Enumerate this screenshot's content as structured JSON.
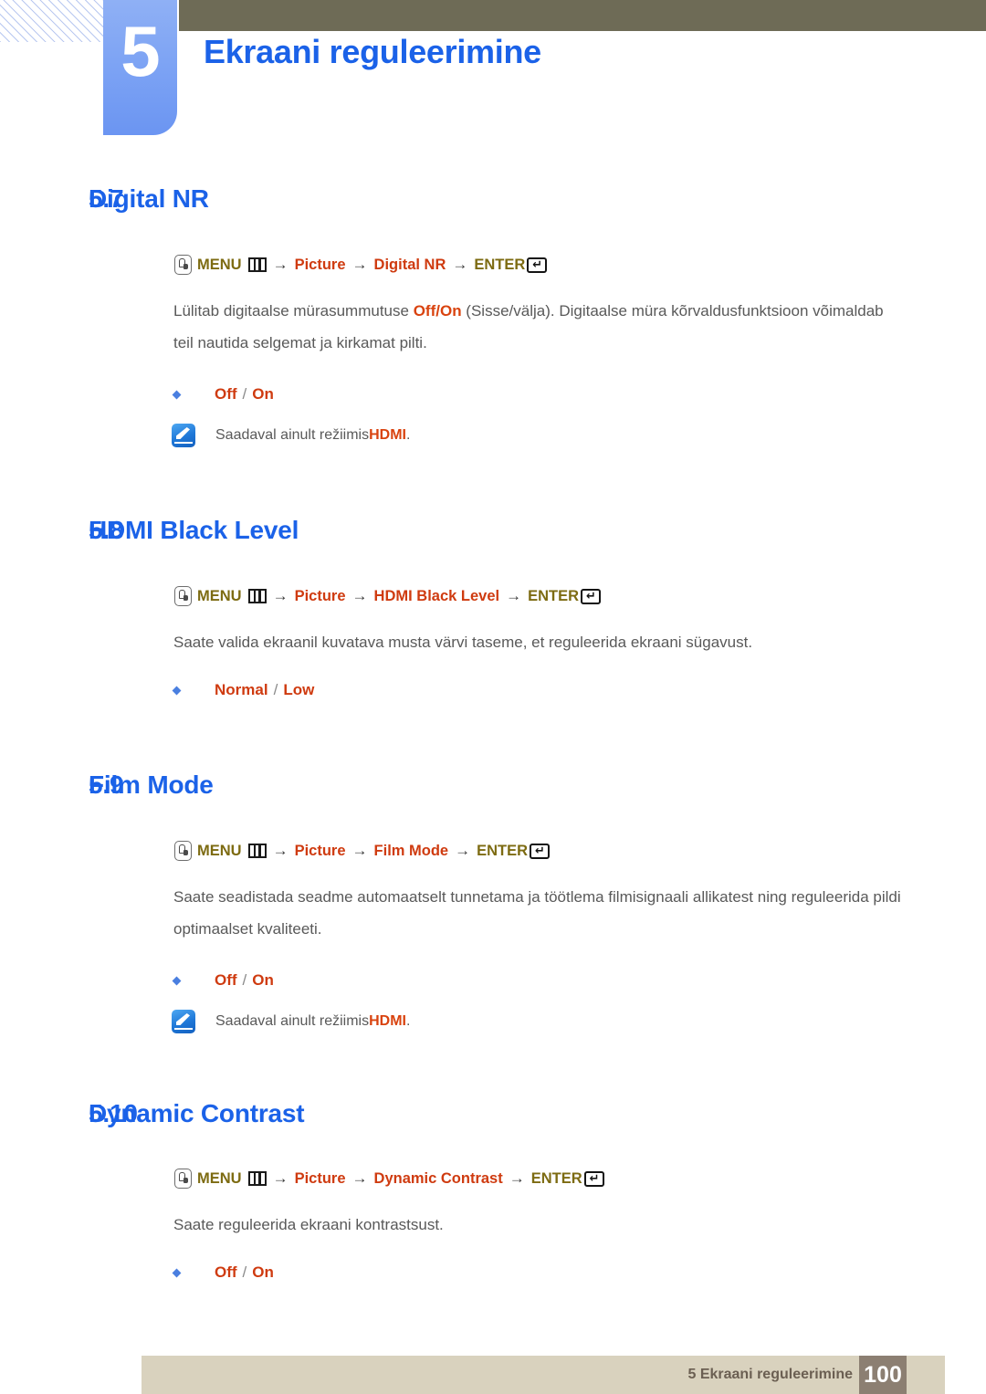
{
  "header": {
    "chapter_number": "5",
    "chapter_title": "Ekraani reguleerimine"
  },
  "sections": [
    {
      "number": "5.7",
      "title": "Digital NR",
      "menu_path": {
        "menu_label": "MENU",
        "arrow": "→",
        "steps": [
          "Picture",
          "Digital NR"
        ],
        "enter_label": "ENTER"
      },
      "body_prefix": "Lülitab digitaalse mürasummutuse ",
      "body_hl1": "Off",
      "body_mid": "/",
      "body_hl2": "On",
      "body_suffix": " (Sisse/välja). Digitaalse müra kõrvaldusfunktsioon võimaldab teil nautida selgemat ja kirkamat pilti.",
      "options": [
        "Off",
        "On"
      ],
      "option_separator": "/",
      "note_prefix": "Saadaval ainult režiimis ",
      "note_hl": "HDMI",
      "note_suffix": "."
    },
    {
      "number": "5.8",
      "title": "HDMI Black Level",
      "menu_path": {
        "menu_label": "MENU",
        "arrow": "→",
        "steps": [
          "Picture",
          "HDMI Black Level"
        ],
        "enter_label": "ENTER"
      },
      "body": "Saate valida ekraanil kuvatava musta värvi taseme, et reguleerida ekraani sügavust.",
      "options": [
        "Normal",
        "Low"
      ],
      "option_separator": "/"
    },
    {
      "number": "5.9",
      "title": "Film Mode",
      "menu_path": {
        "menu_label": "MENU",
        "arrow": "→",
        "steps": [
          "Picture",
          "Film Mode"
        ],
        "enter_label": "ENTER"
      },
      "body": "Saate seadistada seadme automaatselt tunnetama ja töötlema filmisignaali allikatest ning reguleerida pildi optimaalset kvaliteeti.",
      "options": [
        "Off",
        "On"
      ],
      "option_separator": "/",
      "note_prefix": "Saadaval ainult režiimis ",
      "note_hl": "HDMI",
      "note_suffix": "."
    },
    {
      "number": "5.10",
      "title": "Dynamic Contrast",
      "menu_path": {
        "menu_label": "MENU",
        "arrow": "→",
        "steps": [
          "Picture",
          "Dynamic Contrast"
        ],
        "enter_label": "ENTER"
      },
      "body": "Saate reguleerida ekraani kontrastsust.",
      "options": [
        "Off",
        "On"
      ],
      "option_separator": "/"
    }
  ],
  "footer": {
    "text": "5 Ekraani reguleerimine",
    "page_number": "100"
  },
  "icons": {
    "menu_button": "remote-menu-button-icon",
    "menu_grid": "menu-grid-icon",
    "enter_key": "enter-key-icon",
    "note": "note-pen-icon",
    "enter_arrow_glyph": "↵"
  },
  "colors": {
    "heading_blue": "#1b62e8",
    "menu_olive": "#7d6b12",
    "menu_orange": "#cf3b10",
    "body_gray": "#595959",
    "header_olive_bar": "#6e6b56",
    "chapter_blue": "#7ea4f4",
    "footer_beige": "#d9d2be",
    "footer_box": "#8c7f72"
  }
}
